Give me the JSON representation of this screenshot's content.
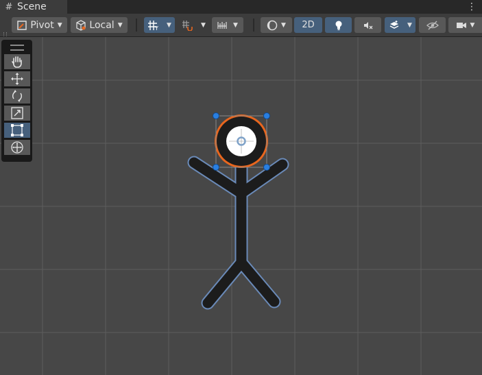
{
  "window": {
    "tab_icon": "hash-icon",
    "tab_title": "Scene",
    "menu_icon": "kebab-menu-icon"
  },
  "toolbar": {
    "pivot_label": "Pivot",
    "local_label": "Local",
    "mode_2d_label": "2D"
  },
  "tools": [
    "hand-tool",
    "move-tool",
    "rotate-tool",
    "scale-tool",
    "rect-tool",
    "transform-tool"
  ],
  "active_tool": "rect-tool",
  "colors": {
    "background": "#474747",
    "toolbar": "#3c3c3c",
    "active": "#46607c",
    "selection_outline": "#e8661e",
    "handle": "#2a7fe0",
    "sprite_outline": "#6a8ab8"
  }
}
